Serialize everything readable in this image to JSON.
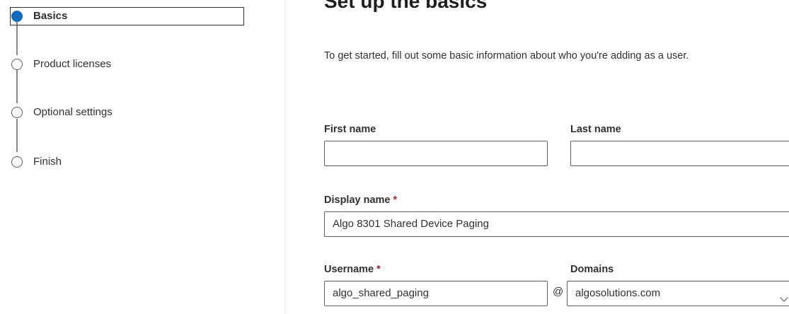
{
  "steps": [
    {
      "label": "Basics",
      "state": "current"
    },
    {
      "label": "Product licenses",
      "state": "pending"
    },
    {
      "label": "Optional settings",
      "state": "pending"
    },
    {
      "label": "Finish",
      "state": "pending"
    }
  ],
  "main": {
    "title": "Set up the basics",
    "intro": "To get started, fill out some basic information about who you're adding as a user.",
    "required_marker": "*",
    "fields": {
      "first_name": {
        "label": "First name",
        "value": ""
      },
      "last_name": {
        "label": "Last name",
        "value": ""
      },
      "display_name": {
        "label": "Display name",
        "value": "Algo 8301 Shared Device Paging"
      },
      "username": {
        "label": "Username",
        "value": "algo_shared_paging"
      },
      "at_symbol": "@",
      "domains": {
        "label": "Domains",
        "value": "algosolutions.com"
      }
    }
  },
  "colors": {
    "accent": "#0f6cbd",
    "required": "#a4262c",
    "border": "#605e5c"
  }
}
